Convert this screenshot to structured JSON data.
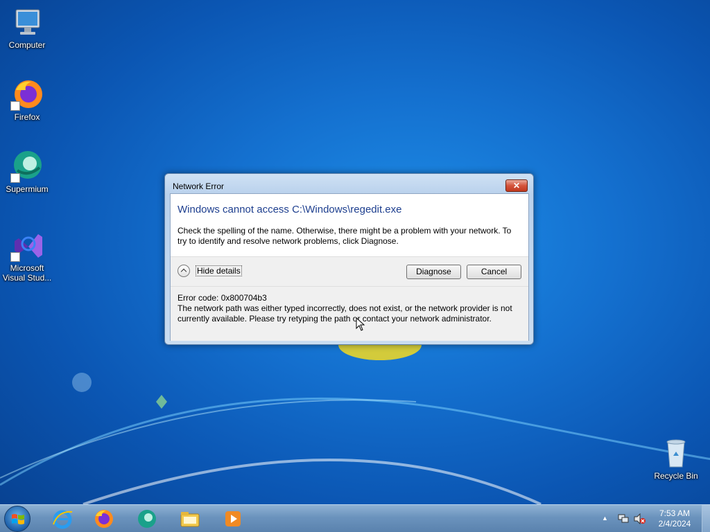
{
  "desktop": {
    "icons": [
      {
        "label": "Computer",
        "icon": "computer-icon"
      },
      {
        "label": "Firefox",
        "icon": "firefox-icon"
      },
      {
        "label": "Supermium",
        "icon": "supermium-icon"
      },
      {
        "label": "Microsoft Visual Stud...",
        "icon": "visual-studio-icon"
      },
      {
        "label": "Recycle Bin",
        "icon": "recycle-bin-icon"
      }
    ]
  },
  "dialog": {
    "title": "Network Error",
    "close_label": "✕",
    "main_instruction": "Windows cannot access C:\\Windows\\regedit.exe",
    "content": "Check the spelling of the name. Otherwise, there might be a problem with your network. To try to identify and resolve network problems, click Diagnose.",
    "expander_label": "Hide details",
    "diagnose_label": "Diagnose",
    "cancel_label": "Cancel",
    "error_code": "Error code: 0x800704b3",
    "error_details": "The network path was either typed incorrectly, does not exist, or the network provider is not currently available. Please try retyping the path or contact your network administrator."
  },
  "taskbar": {
    "pinned": [
      "internet-explorer-icon",
      "firefox-icon",
      "supermium-icon",
      "file-explorer-icon",
      "media-player-icon"
    ],
    "clock": {
      "time": "7:53 AM",
      "date": "2/4/2024"
    }
  }
}
